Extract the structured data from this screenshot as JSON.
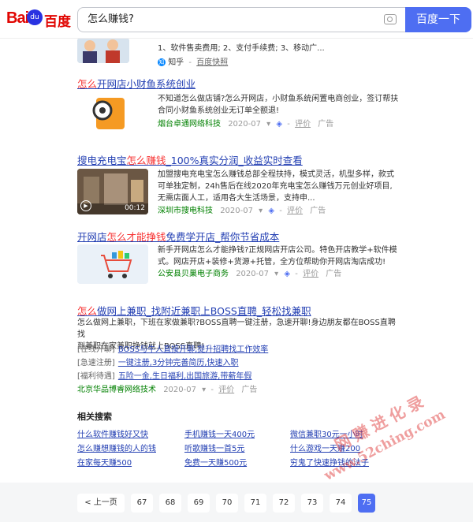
{
  "header": {
    "logo_text": "Bai",
    "logo_paw": "du",
    "logo_cn": "百度",
    "search_value": "怎么赚钱?",
    "search_button": "百度一下"
  },
  "top_result": {
    "desc_top": "1、软件售卖费用; 2、支付手续费; 3、移动广...",
    "source": "知乎",
    "snapshot": "百度快照"
  },
  "results": [
    {
      "title_pre": "怎么",
      "title_rest": "开网店小财鱼系统创业",
      "desc_lines": [
        "不知道怎么做店铺?怎么开网店，小财鱼系统闲置电商创业，签订帮扶",
        "合同小财鱼系统创业无订单全额退!"
      ],
      "source": "烟台卓通网络科技",
      "date": "2020-07",
      "comment": "评价",
      "ad": "广告"
    },
    {
      "title_a": "搜电充电宝",
      "title_em": "怎么赚钱",
      "title_b": "_100%真实分润_收益实时查看",
      "desc_lines": [
        "加盟搜电充电宝怎么赚钱总部全程扶持，模式灵活，机型多样，款式",
        "可单独定制，24h售后在线2020年充电宝怎么赚钱万元创业好项目,",
        "无需店面人工，适用各大生活场景，支持申..."
      ],
      "video_time": "00:12",
      "source": "深圳市搜电科技",
      "date": "2020-07",
      "comment": "评价",
      "ad": "广告"
    },
    {
      "title_a": "开网店",
      "title_em": "怎么才能挣钱",
      "title_b": "免费学开店_帮你节省成本",
      "desc_lines": [
        "新手开网店怎么才能挣钱?正规网店开店公司。特色开店教学+软件模",
        "式。网店开店+装修+货源+托管，全方位帮助你开网店淘店成功!"
      ],
      "source": "公安县贝巢电子商务",
      "date": "2020-07",
      "comment": "评价",
      "ad": "广告"
    },
    {
      "title_em": "怎么",
      "title_b": "做网上兼职_找附近兼职上BOSS直聘_轻松找兼职",
      "desc_lines": [
        "怎么做网上兼职，下班在家做兼职?BOSS直聘一键注册，急速开聊!身边朋友都在BOSS直聘找",
        "到兼职在家兼职挣钱就上BOSS直聘!"
      ],
      "sublinks": [
        {
          "tag": "[在线开聊]",
          "text": "BOSS与牛人直接开聊,提升招聘找工作效率"
        },
        {
          "tag": "[急速注册]",
          "text": "一键注册,3分钟完善简历,快速入职"
        },
        {
          "tag": "[福利待遇]",
          "text": "五险一金,生日福利,出国旅游,带薪年假"
        }
      ],
      "source": "北京华品博睿网络技术",
      "date": "2020-07",
      "comment": "评价",
      "ad": "广告"
    }
  ],
  "related": {
    "title": "相关搜索",
    "items": [
      "什么软件赚钱好又快",
      "手机赚钱一天400元",
      "微信兼职30元一小时",
      "怎么赚想赚钱的人的钱",
      "听歌赚钱一首5元",
      "什么游戏一天赚200",
      "在家每天赚500",
      "免费一天赚500元",
      "穷鬼了快速挣钱的法子"
    ]
  },
  "pager": {
    "prev": "< 上一页",
    "pages": [
      "67",
      "68",
      "69",
      "70",
      "71",
      "72",
      "73",
      "74",
      "75"
    ],
    "current": "75"
  },
  "watermark": {
    "line1": "网赚进化录",
    "line2": "www.52ching.com"
  }
}
